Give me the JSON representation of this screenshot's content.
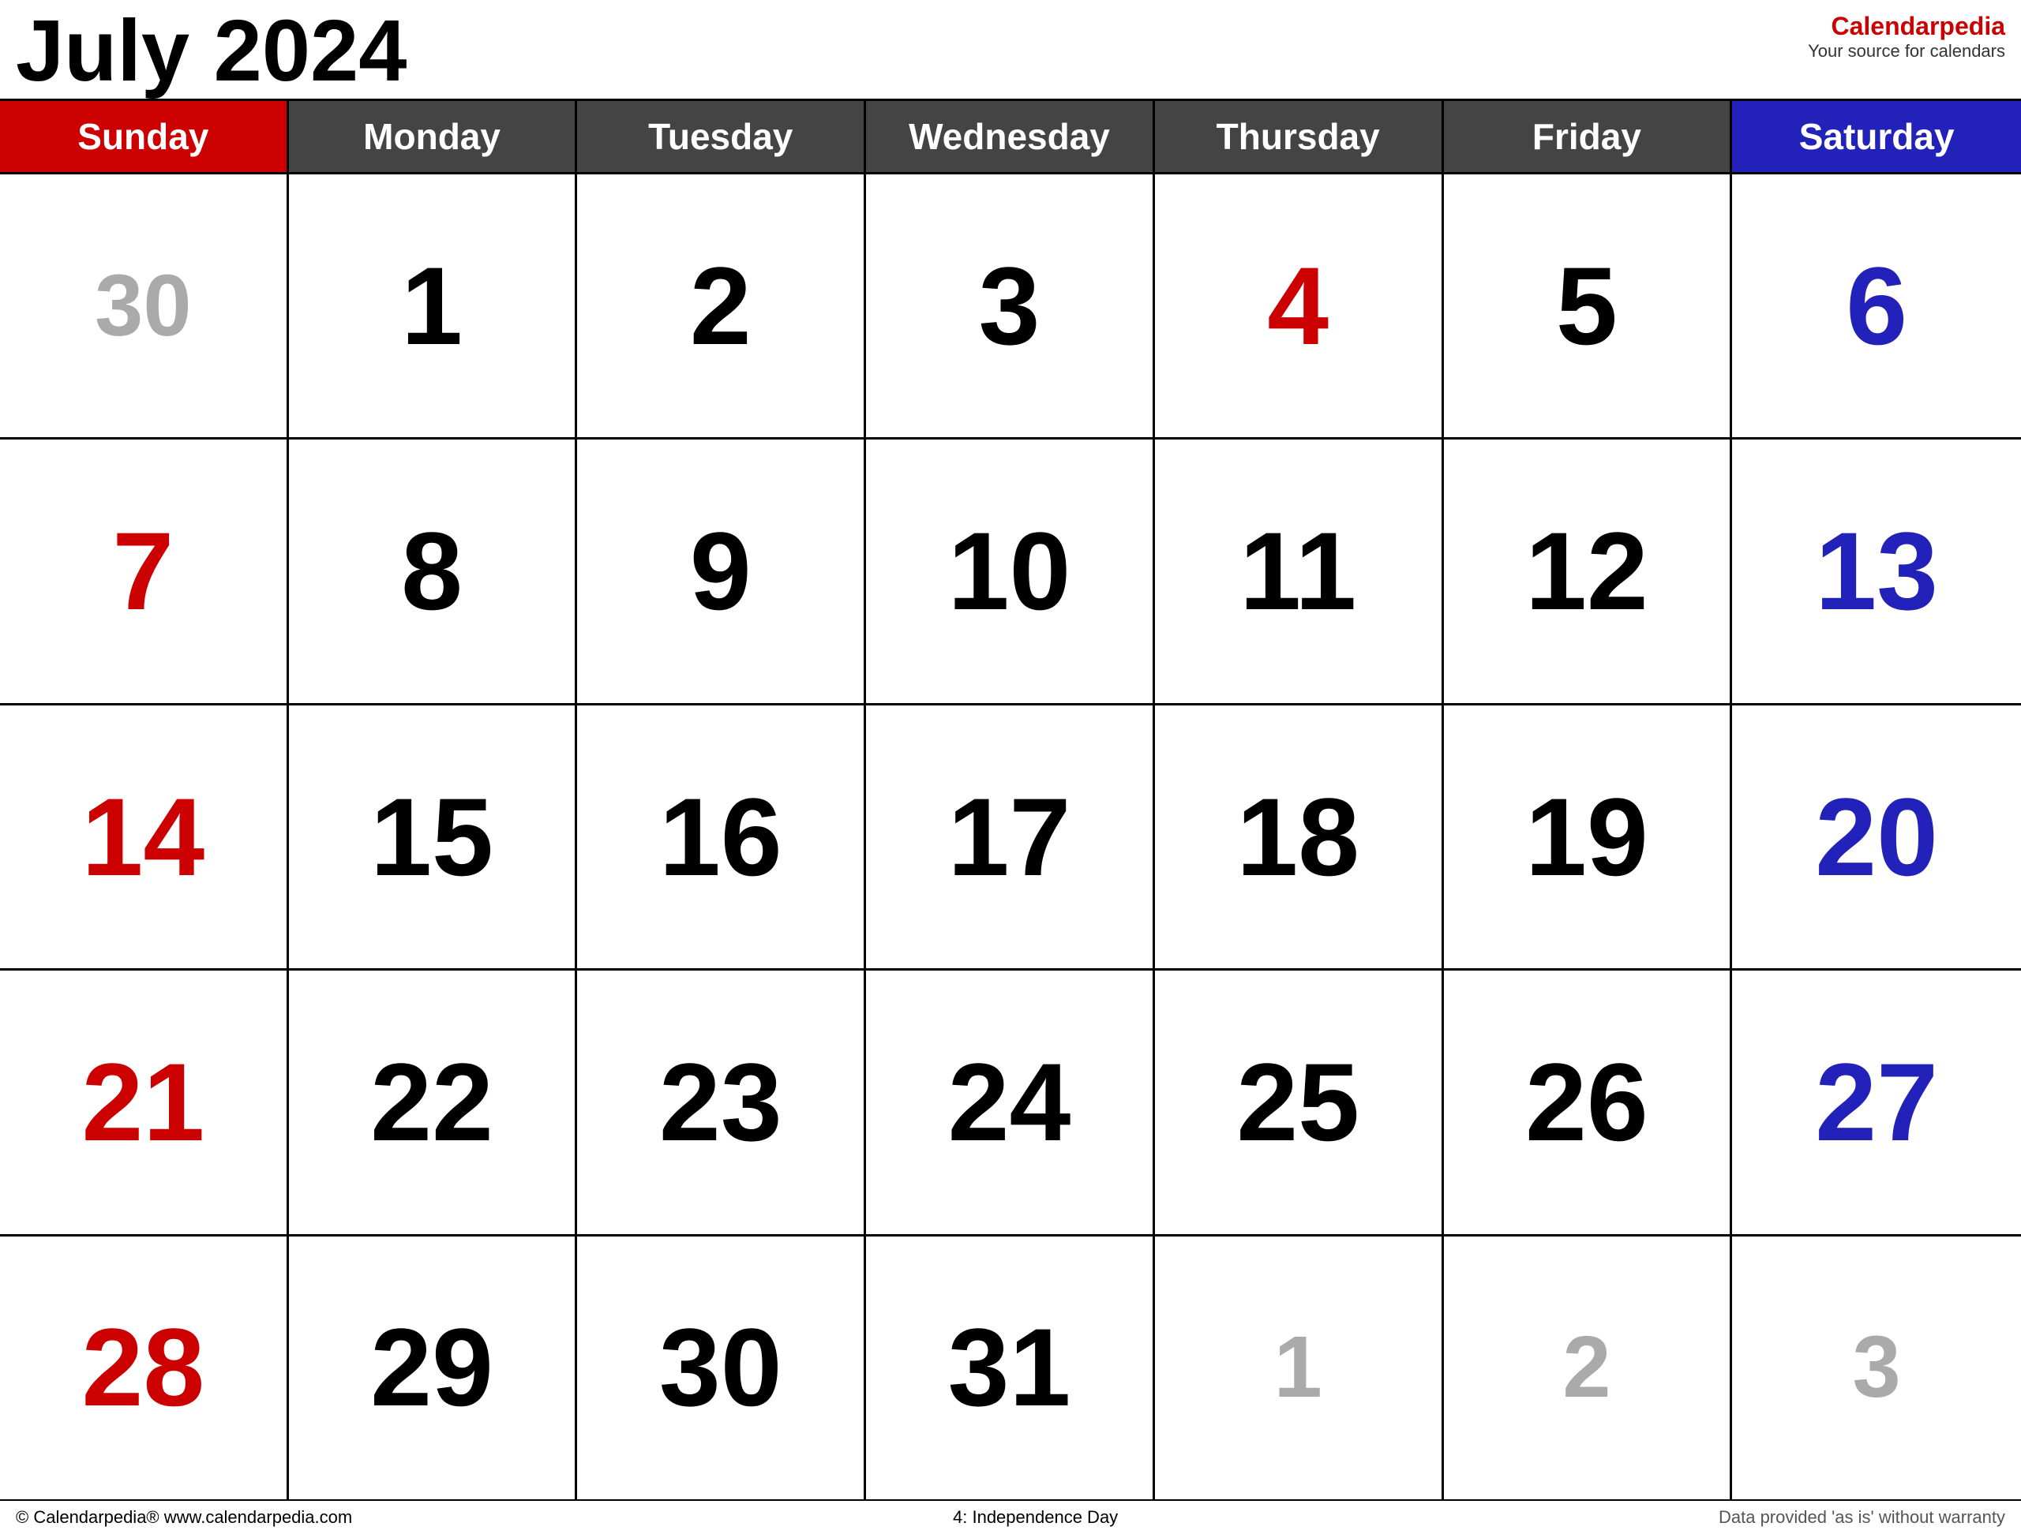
{
  "header": {
    "title": "July 2024",
    "brand_name": "Calendar",
    "brand_name_accent": "pedia",
    "brand_tagline": "Your source for calendars"
  },
  "day_headers": [
    {
      "label": "Sunday",
      "type": "sunday"
    },
    {
      "label": "Monday",
      "type": "weekday"
    },
    {
      "label": "Tuesday",
      "type": "weekday"
    },
    {
      "label": "Wednesday",
      "type": "weekday"
    },
    {
      "label": "Thursday",
      "type": "weekday"
    },
    {
      "label": "Friday",
      "type": "weekday"
    },
    {
      "label": "Saturday",
      "type": "saturday"
    }
  ],
  "weeks": [
    [
      {
        "day": "30",
        "type": "gray"
      },
      {
        "day": "1",
        "type": "black"
      },
      {
        "day": "2",
        "type": "black"
      },
      {
        "day": "3",
        "type": "black"
      },
      {
        "day": "4",
        "type": "red"
      },
      {
        "day": "5",
        "type": "black"
      },
      {
        "day": "6",
        "type": "blue"
      }
    ],
    [
      {
        "day": "7",
        "type": "red"
      },
      {
        "day": "8",
        "type": "black"
      },
      {
        "day": "9",
        "type": "black"
      },
      {
        "day": "10",
        "type": "black"
      },
      {
        "day": "11",
        "type": "black"
      },
      {
        "day": "12",
        "type": "black"
      },
      {
        "day": "13",
        "type": "blue"
      }
    ],
    [
      {
        "day": "14",
        "type": "red"
      },
      {
        "day": "15",
        "type": "black"
      },
      {
        "day": "16",
        "type": "black"
      },
      {
        "day": "17",
        "type": "black"
      },
      {
        "day": "18",
        "type": "black"
      },
      {
        "day": "19",
        "type": "black"
      },
      {
        "day": "20",
        "type": "blue"
      }
    ],
    [
      {
        "day": "21",
        "type": "red"
      },
      {
        "day": "22",
        "type": "black"
      },
      {
        "day": "23",
        "type": "black"
      },
      {
        "day": "24",
        "type": "black"
      },
      {
        "day": "25",
        "type": "black"
      },
      {
        "day": "26",
        "type": "black"
      },
      {
        "day": "27",
        "type": "blue"
      }
    ],
    [
      {
        "day": "28",
        "type": "red"
      },
      {
        "day": "29",
        "type": "black"
      },
      {
        "day": "30",
        "type": "black"
      },
      {
        "day": "31",
        "type": "black"
      },
      {
        "day": "1",
        "type": "gray"
      },
      {
        "day": "2",
        "type": "gray"
      },
      {
        "day": "3",
        "type": "gray"
      }
    ]
  ],
  "footer": {
    "left": "© Calendarpedia®   www.calendarpedia.com",
    "center": "4: Independence Day",
    "right": "Data provided 'as is' without warranty"
  }
}
